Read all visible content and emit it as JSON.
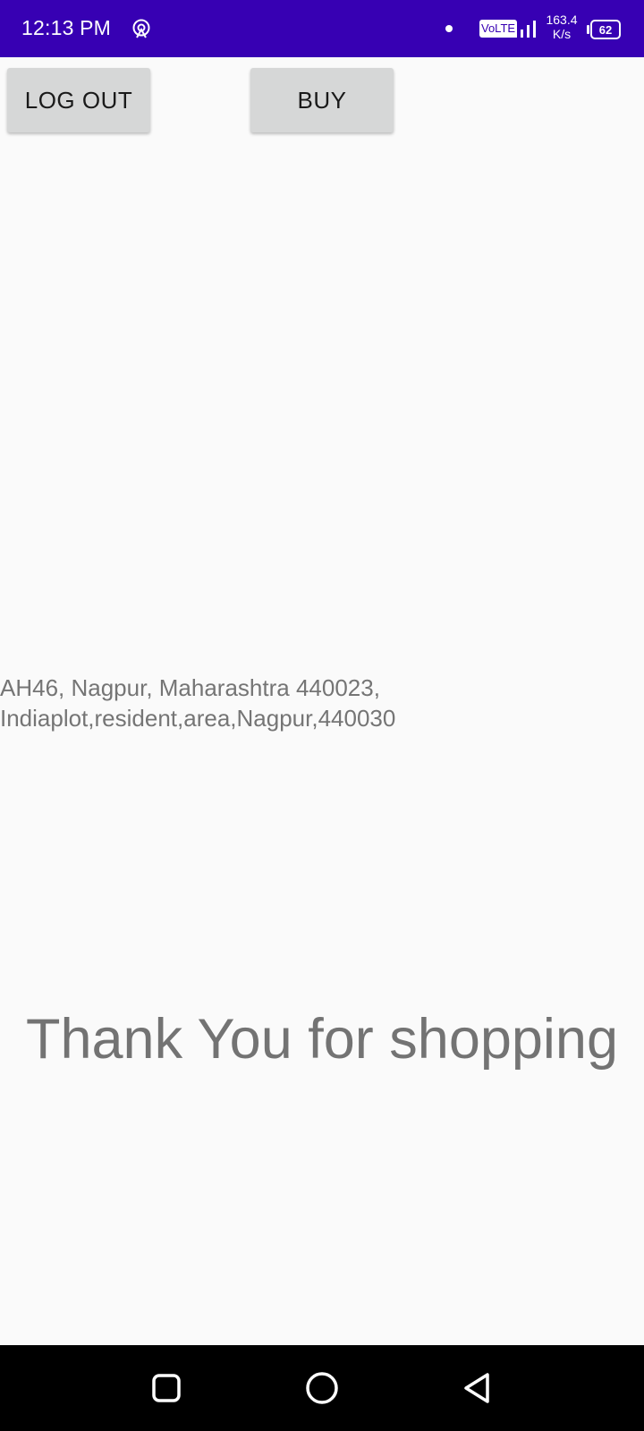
{
  "status_bar": {
    "time": "12:13 PM",
    "volte": "VoLTE",
    "net_speed_value": "163.4",
    "net_speed_unit": "K/s",
    "battery": "62",
    "icons": [
      "hotspot-icon",
      "notification-dot-icon",
      "signal-icon",
      "battery-icon"
    ]
  },
  "toolbar": {
    "logout_label": "LOG OUT",
    "buy_label": "BUY"
  },
  "address": {
    "line1": "AH46, Nagpur, Maharashtra 440023,",
    "line2": "Indiaplot,resident,area,Nagpur,440030"
  },
  "message": {
    "thanks": "Thank You for shopping"
  },
  "nav_bar": {
    "icons": [
      "recents-icon",
      "home-icon",
      "back-icon"
    ]
  },
  "colors": {
    "status_bar": "#3700b3",
    "background": "#fafafa",
    "button": "#d6d7d7",
    "text_gray": "#757575"
  }
}
